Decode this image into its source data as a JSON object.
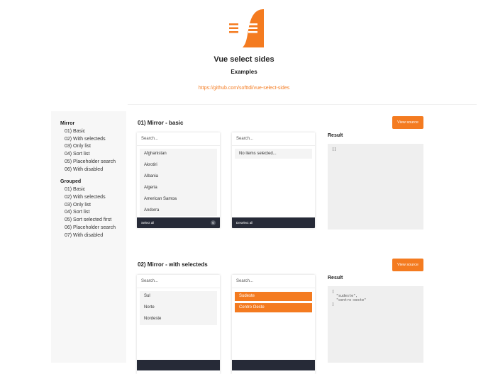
{
  "header": {
    "title": "Vue select sides",
    "subtitle": "Examples",
    "link": "https://github.com/softtdi/vue-select-sides",
    "brand_color": "#f47b20"
  },
  "sidebar": {
    "groups": [
      {
        "title": "Mirror",
        "items": [
          "01) Basic",
          "02) With selecteds",
          "03) Only list",
          "04) Sort list",
          "05) Placeholder search",
          "06) With disabled"
        ]
      },
      {
        "title": "Grouped",
        "items": [
          "01) Basic",
          "02) With selecteds",
          "03) Only list",
          "04) Sort list",
          "05) Sort selected first",
          "06) Placeholder search",
          "07) With disabled"
        ]
      }
    ]
  },
  "sections": [
    {
      "title": "01) Mirror - basic",
      "view_source": "View source",
      "left": {
        "search_placeholder": "Search...",
        "items": [
          "Afghanistan",
          "Akrotiri",
          "Albania",
          "Algeria",
          "American Samoa",
          "Andorra"
        ],
        "footer": "Select all",
        "badge": "0"
      },
      "right": {
        "search_placeholder": "Search...",
        "empty_text": "No items selected...",
        "footer": "Deselect all"
      },
      "result_label": "Result",
      "result_text": "[]"
    },
    {
      "title": "02) Mirror - with selecteds",
      "view_source": "View source",
      "left": {
        "search_placeholder": "Search...",
        "items": [
          "Sul",
          "Norte",
          "Nordeste"
        ]
      },
      "right": {
        "search_placeholder": "Search...",
        "selected": [
          "Sudeste",
          "Centro Oeste"
        ]
      },
      "result_label": "Result",
      "result_text": "[\n  \"sudeste\",\n  \"centro-oeste\"\n]"
    }
  ]
}
